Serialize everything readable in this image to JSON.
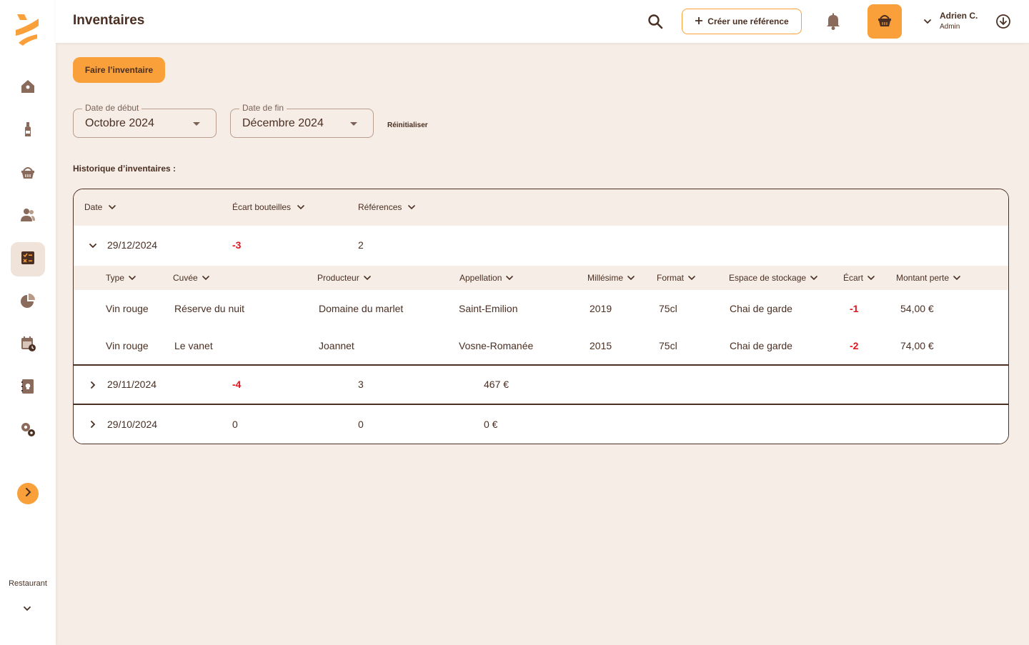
{
  "header": {
    "title": "Inventaires",
    "create_label": "Créer une référence",
    "user_name": "Adrien C.",
    "user_role": "Admin"
  },
  "sidebar": {
    "restaurant_label": "Restaurant",
    "items": [
      {
        "name": "home"
      },
      {
        "name": "bottle"
      },
      {
        "name": "basket"
      },
      {
        "name": "users"
      },
      {
        "name": "inventory",
        "active": true
      },
      {
        "name": "pie-chart"
      },
      {
        "name": "calendar"
      },
      {
        "name": "recipe-book"
      },
      {
        "name": "settings"
      }
    ]
  },
  "main": {
    "primary_button": "Faire l’inventaire",
    "start_date": {
      "label": "Date de début",
      "value": "Octobre 2024"
    },
    "end_date": {
      "label": "Date de fin",
      "value": "Décembre 2024"
    },
    "reset_label": "Réinitialiser",
    "history_title": "Historique d’inventaires :"
  },
  "table": {
    "headers": {
      "date": "Date",
      "ecart": "Écart bouteilles",
      "references": "Références"
    },
    "sub_headers": {
      "type": "Type",
      "cuvee": "Cuvée",
      "producteur": "Producteur",
      "appellation": "Appellation",
      "millesime": "Millésime",
      "format": "Format",
      "espace": "Espace de stockage",
      "ecart": "Écart",
      "montant": "Montant perte"
    },
    "rows": [
      {
        "date": "29/12/2024",
        "ecart": "-3",
        "references": "2",
        "details": [
          {
            "type": "Vin rouge",
            "cuvee": "Réserve du nuit",
            "producteur": "Domaine du marlet",
            "appellation": "Saint-Emilion",
            "millesime": "2019",
            "format": "75cl",
            "espace": "Chai de garde",
            "ecart": "-1",
            "montant": "54,00 €"
          },
          {
            "type": "Vin rouge",
            "cuvee": "Le vanet",
            "producteur": "Joannet",
            "appellation": "Vosne-Romanée",
            "millesime": "2015",
            "format": "75cl",
            "espace": "Chai de garde",
            "ecart": "-2",
            "montant": "74,00 €"
          }
        ]
      },
      {
        "date": "29/11/2024",
        "ecart": "-4",
        "references": "3",
        "amount": "467 €"
      },
      {
        "date": "29/10/2024",
        "ecart": "0",
        "references": "0",
        "amount": "0 €"
      }
    ]
  },
  "colors": {
    "accent": "#f9a03a",
    "text": "#4a2f22",
    "background": "#f5ede6",
    "negative": "#e0141e"
  }
}
